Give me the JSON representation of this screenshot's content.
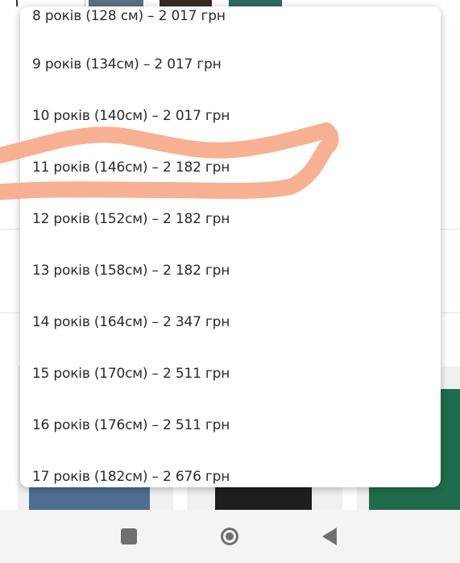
{
  "dropdown": {
    "options": [
      "8 років (128 см) – 2 017 грн",
      "9 років (134см) – 2 017 грн",
      "10 років (140см) – 2 017 грн",
      "11 років (146см) – 2 182 грн",
      "12 років (152см) – 2 182 грн",
      "13 років (158см) – 2 182 грн",
      "14 років (164см) – 2 347 грн",
      "15 років (170см) – 2 511 грн",
      "16 років (176см) – 2 511 грн",
      "17 років (182см) – 2 676 грн"
    ],
    "highlighted_option_index": 3
  },
  "colors": {
    "marker": "#f7a98a",
    "nav_icon": "#6f6f6f",
    "text": "#2a2a2a"
  },
  "navbar": {
    "icons": [
      "recent-apps-icon",
      "home-icon",
      "back-icon"
    ]
  }
}
